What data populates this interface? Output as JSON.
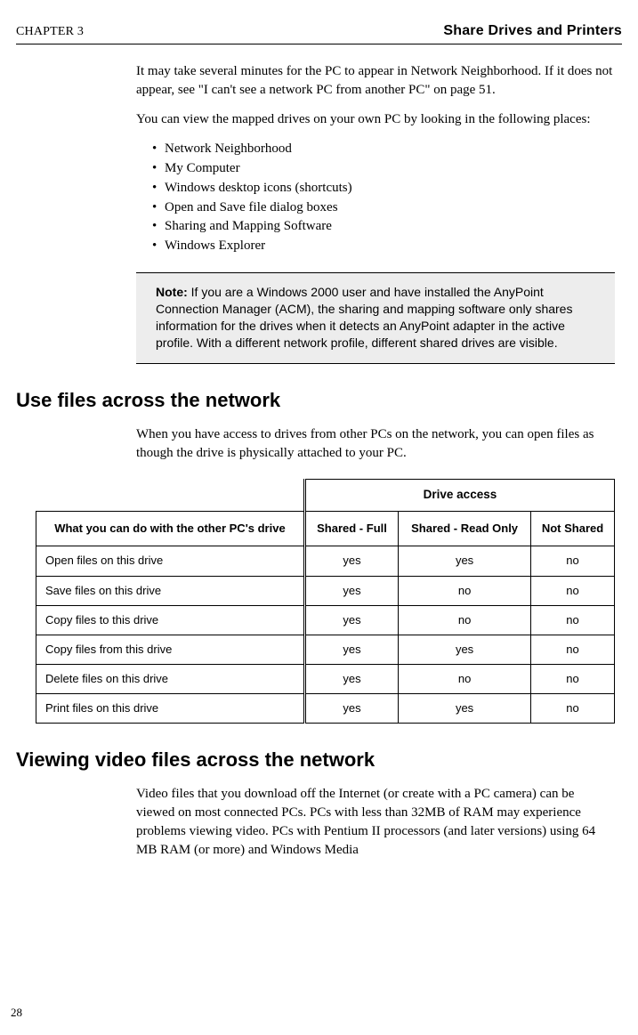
{
  "header": {
    "chapter": "CHAPTER 3",
    "title": "Share Drives and Printers"
  },
  "intro": {
    "p1": "It may take several minutes for the PC to appear in Network Neighborhood. If it does not appear, see \"I can't see a network PC from another PC\" on page 51.",
    "p2": "You can view the mapped drives on your own PC by looking in the following places:",
    "bullets": [
      "Network Neighborhood",
      "My Computer",
      "Windows desktop icons (shortcuts)",
      "Open and Save file dialog boxes",
      "Sharing and Mapping Software",
      "Windows Explorer"
    ]
  },
  "note": {
    "label": "Note:",
    "text": "  If you are a Windows 2000 user and have installed the AnyPoint Connection Manager (ACM), the sharing and mapping software only shares information for the drives when it detects an AnyPoint adapter in the active profile. With a different network profile, different shared drives are visible."
  },
  "section1": {
    "heading": "Use files across the network",
    "p1": "When you have access to drives from other PCs on the network, you can open files as though the drive is physically attached to your PC."
  },
  "table": {
    "group_head": "Drive access",
    "row_head": "What you can do with the other PC's drive",
    "cols": [
      "Shared - Full",
      "Shared - Read Only",
      "Not Shared"
    ],
    "rows": [
      {
        "label": "Open files on this drive",
        "c1": "yes",
        "c2": "yes",
        "c3": "no"
      },
      {
        "label": "Save files on this drive",
        "c1": "yes",
        "c2": "no",
        "c3": "no"
      },
      {
        "label": "Copy files to this drive",
        "c1": "yes",
        "c2": "no",
        "c3": "no"
      },
      {
        "label": "Copy files from this drive",
        "c1": "yes",
        "c2": "yes",
        "c3": "no"
      },
      {
        "label": "Delete files on this drive",
        "c1": "yes",
        "c2": "no",
        "c3": "no"
      },
      {
        "label": "Print files on this drive",
        "c1": "yes",
        "c2": "yes",
        "c3": "no"
      }
    ]
  },
  "section2": {
    "heading": "Viewing video files across the network",
    "p1": "Video files that you download off the Internet (or create with a PC camera) can be viewed on most connected PCs. PCs with less than 32MB of RAM may experience problems viewing video. PCs with Pentium II processors (and later versions) using 64 MB RAM (or more) and Windows Media"
  },
  "page_number": "28"
}
